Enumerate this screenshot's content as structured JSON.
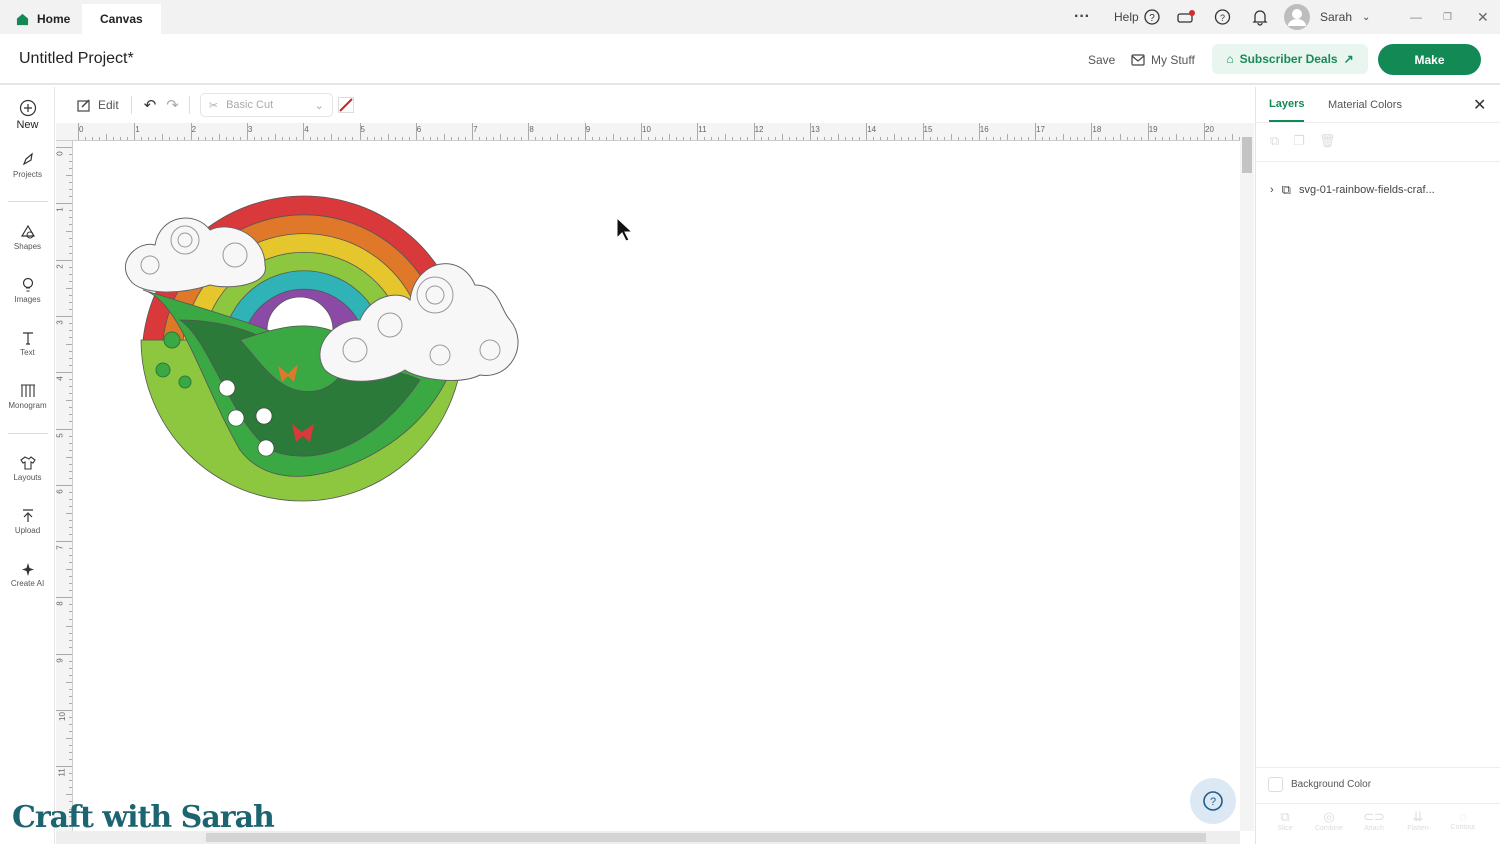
{
  "topbar": {
    "tabs": [
      {
        "label": "Home"
      },
      {
        "label": "Canvas"
      }
    ],
    "help": "Help",
    "user": "Sarah"
  },
  "header": {
    "project_title": "Untitled Project*",
    "save": "Save",
    "my_stuff": "My Stuff",
    "subscriber_deals": "Subscriber Deals",
    "make": "Make"
  },
  "leftbar": {
    "items": [
      {
        "label": "New"
      },
      {
        "label": "Projects"
      },
      {
        "label": "Shapes"
      },
      {
        "label": "Images"
      },
      {
        "label": "Text"
      },
      {
        "label": "Monogram"
      },
      {
        "label": "Layouts"
      },
      {
        "label": "Upload"
      },
      {
        "label": "Create AI"
      }
    ]
  },
  "toolbar": {
    "edit": "Edit",
    "operation": "Basic Cut"
  },
  "ruler": {
    "h": [
      "0",
      "1",
      "2",
      "3",
      "4",
      "5",
      "6",
      "7",
      "8",
      "9",
      "10",
      "11",
      "12",
      "13",
      "14",
      "15",
      "16",
      "17",
      "18",
      "19",
      "20"
    ],
    "v": [
      "0",
      "1",
      "2",
      "3",
      "4",
      "5",
      "6",
      "7",
      "8",
      "9",
      "10",
      "11"
    ]
  },
  "panel": {
    "tabs": [
      {
        "label": "Layers"
      },
      {
        "label": "Material Colors"
      }
    ],
    "layer_name": "svg-01-rainbow-fields-craf...",
    "background_color": "Background Color",
    "actions": [
      {
        "label": "Slice"
      },
      {
        "label": "Combine"
      },
      {
        "label": "Attach"
      },
      {
        "label": "Flatten"
      },
      {
        "label": "Contour"
      }
    ]
  },
  "watermark": "Craft with Sarah",
  "colors": {
    "accent": "#138a55",
    "rainbow": [
      "#d9393b",
      "#e0782a",
      "#e5c62c",
      "#8dc63f",
      "#2fb3b7",
      "#8a4aa6"
    ]
  }
}
